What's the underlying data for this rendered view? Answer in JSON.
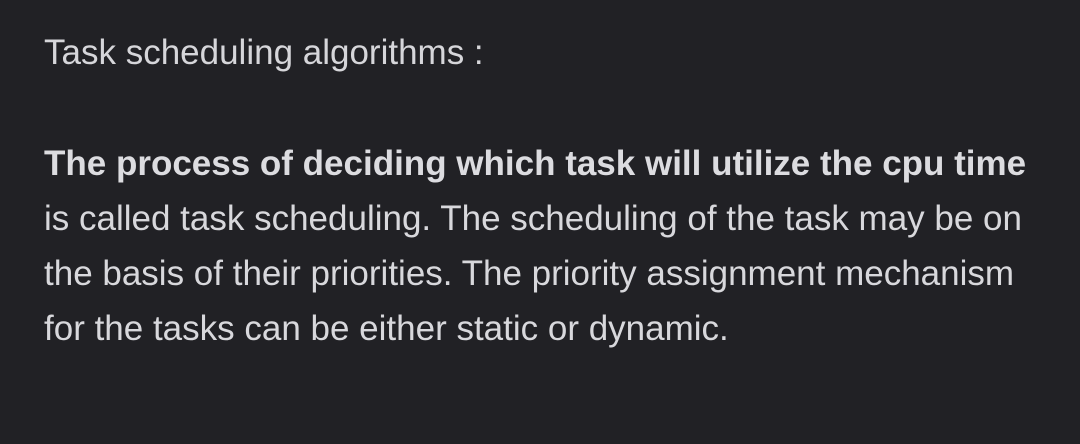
{
  "answer": {
    "heading": "Task scheduling algorithms :",
    "bold_phrase": " The process of deciding which task will utilize the cpu time",
    "body_rest": " is called task scheduling. The scheduling of the task may be on the basis of their priorities. The priority assignment mechanism for the tasks can be either static or dynamic."
  },
  "colors": {
    "background": "#212125",
    "text": "#d8d8dc"
  }
}
